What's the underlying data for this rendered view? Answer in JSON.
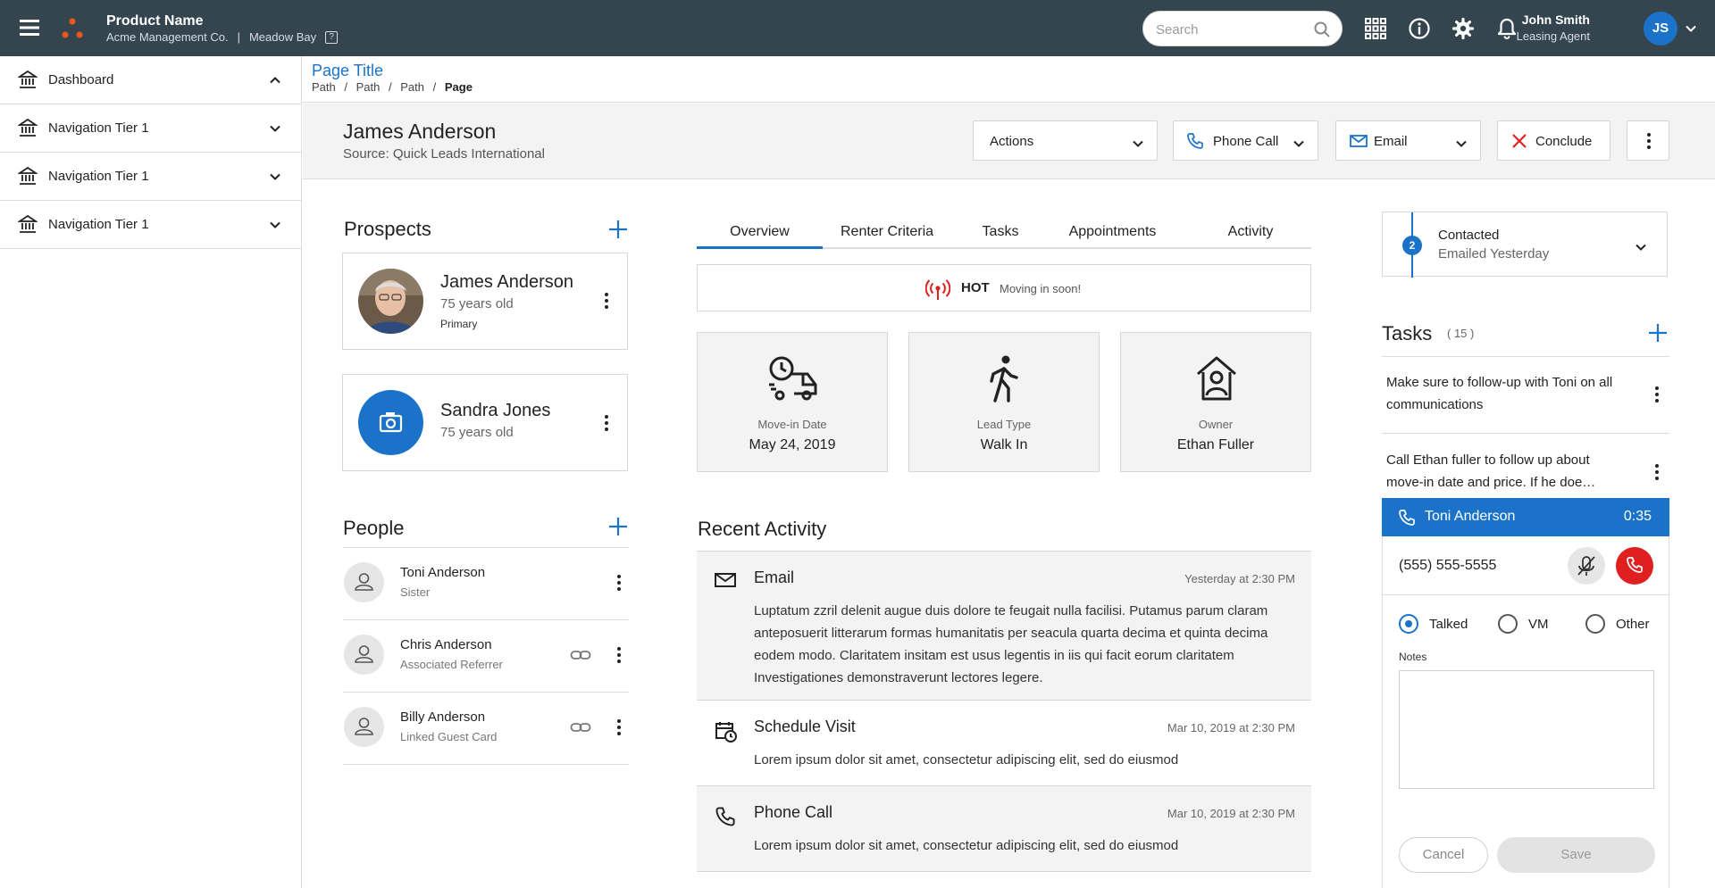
{
  "topbar": {
    "product_name": "Product Name",
    "company": "Acme Management Co.",
    "separator": "|",
    "property": "Meadow Bay",
    "help_glyph": "?",
    "search_placeholder": "Search",
    "user_name": "John Smith",
    "user_role": "Leasing Agent",
    "user_initials": "JS",
    "icons": [
      "menu-icon",
      "apps-grid-icon",
      "info-icon",
      "gear-icon",
      "bell-icon",
      "chevron-down-icon"
    ],
    "colors": {
      "bar": "#344550",
      "accent": "#1a73c8",
      "logo": "#e8571e"
    }
  },
  "sidebar": {
    "items": [
      {
        "label": "Dashboard",
        "chevron": "up"
      },
      {
        "label": "Navigation Tier 1",
        "chevron": "down"
      },
      {
        "label": "Navigation Tier 1",
        "chevron": "down"
      },
      {
        "label": "Navigation Tier 1",
        "chevron": "down"
      }
    ]
  },
  "breadcrumb": {
    "title": "Page Title",
    "parts": [
      "Path",
      "Path",
      "Path"
    ],
    "current": "Page",
    "sep": "/"
  },
  "header": {
    "name": "James Anderson",
    "source": "Source: Quick Leads International",
    "actions_label": "Actions",
    "phone_label": "Phone Call",
    "email_label": "Email",
    "conclude_label": "Conclude"
  },
  "prospects": {
    "title": "Prospects",
    "items": [
      {
        "name": "James Anderson",
        "age": "75 years old",
        "tag": "Primary"
      },
      {
        "name": "Sandra Jones",
        "age": "75 years old",
        "tag": ""
      }
    ]
  },
  "people": {
    "title": "People",
    "items": [
      {
        "name": "Toni Anderson",
        "relation": "Sister",
        "linked": false
      },
      {
        "name": "Chris Anderson",
        "relation": "Associated Referrer",
        "linked": true
      },
      {
        "name": "Billy Anderson",
        "relation": "Linked Guest Card",
        "linked": true
      }
    ]
  },
  "tabs": [
    "Overview",
    "Renter Criteria",
    "Tasks",
    "Appointments",
    "Activity"
  ],
  "active_tab": "Overview",
  "hot": {
    "label": "HOT",
    "message": "Moving in soon!"
  },
  "tiles": [
    {
      "label": "Move-in Date",
      "value": "May 24, 2019",
      "icon": "moving-truck-icon"
    },
    {
      "label": "Lead Type",
      "value": "Walk In",
      "icon": "walking-person-icon"
    },
    {
      "label": "Owner",
      "value": "Ethan Fuller",
      "icon": "owner-house-icon"
    }
  ],
  "recent_activity": {
    "title": "Recent Activity",
    "items": [
      {
        "type": "Email",
        "date": "Yesterday at 2:30 PM",
        "body": "Luptatum zzril delenit augue duis dolore te feugait nulla facilisi. Putamus parum claram anteposuerit litterarum formas humanitatis per seacula quarta decima et quinta decima eodem modo. Claritatem insitam est usus legentis in iis qui facit eorum claritatem Investigationes demonstraverunt lectores legere."
      },
      {
        "type": "Schedule Visit",
        "date": "Mar 10, 2019 at 2:30 PM",
        "body": "Lorem ipsum dolor sit amet, consectetur adipiscing elit, sed do eiusmod"
      },
      {
        "type": "Phone Call",
        "date": "Mar 10, 2019 at 2:30 PM",
        "body": "Lorem ipsum dolor sit amet, consectetur adipiscing elit, sed do eiusmod"
      }
    ]
  },
  "status": {
    "step": "2",
    "title": "Contacted",
    "subtitle": "Emailed Yesterday"
  },
  "tasks": {
    "title": "Tasks",
    "count": "( 15 )",
    "items": [
      "Make sure to follow-up with Toni on all communications",
      "Call Ethan fuller to follow up about move-in date and price. If he doe…"
    ]
  },
  "call": {
    "name": "Toni Anderson",
    "timer": "0:35",
    "number": "(555) 555-5555",
    "options": [
      "Talked",
      "VM",
      "Other"
    ],
    "selected": "Talked",
    "notes_label": "Notes",
    "cancel_label": "Cancel",
    "save_label": "Save"
  }
}
